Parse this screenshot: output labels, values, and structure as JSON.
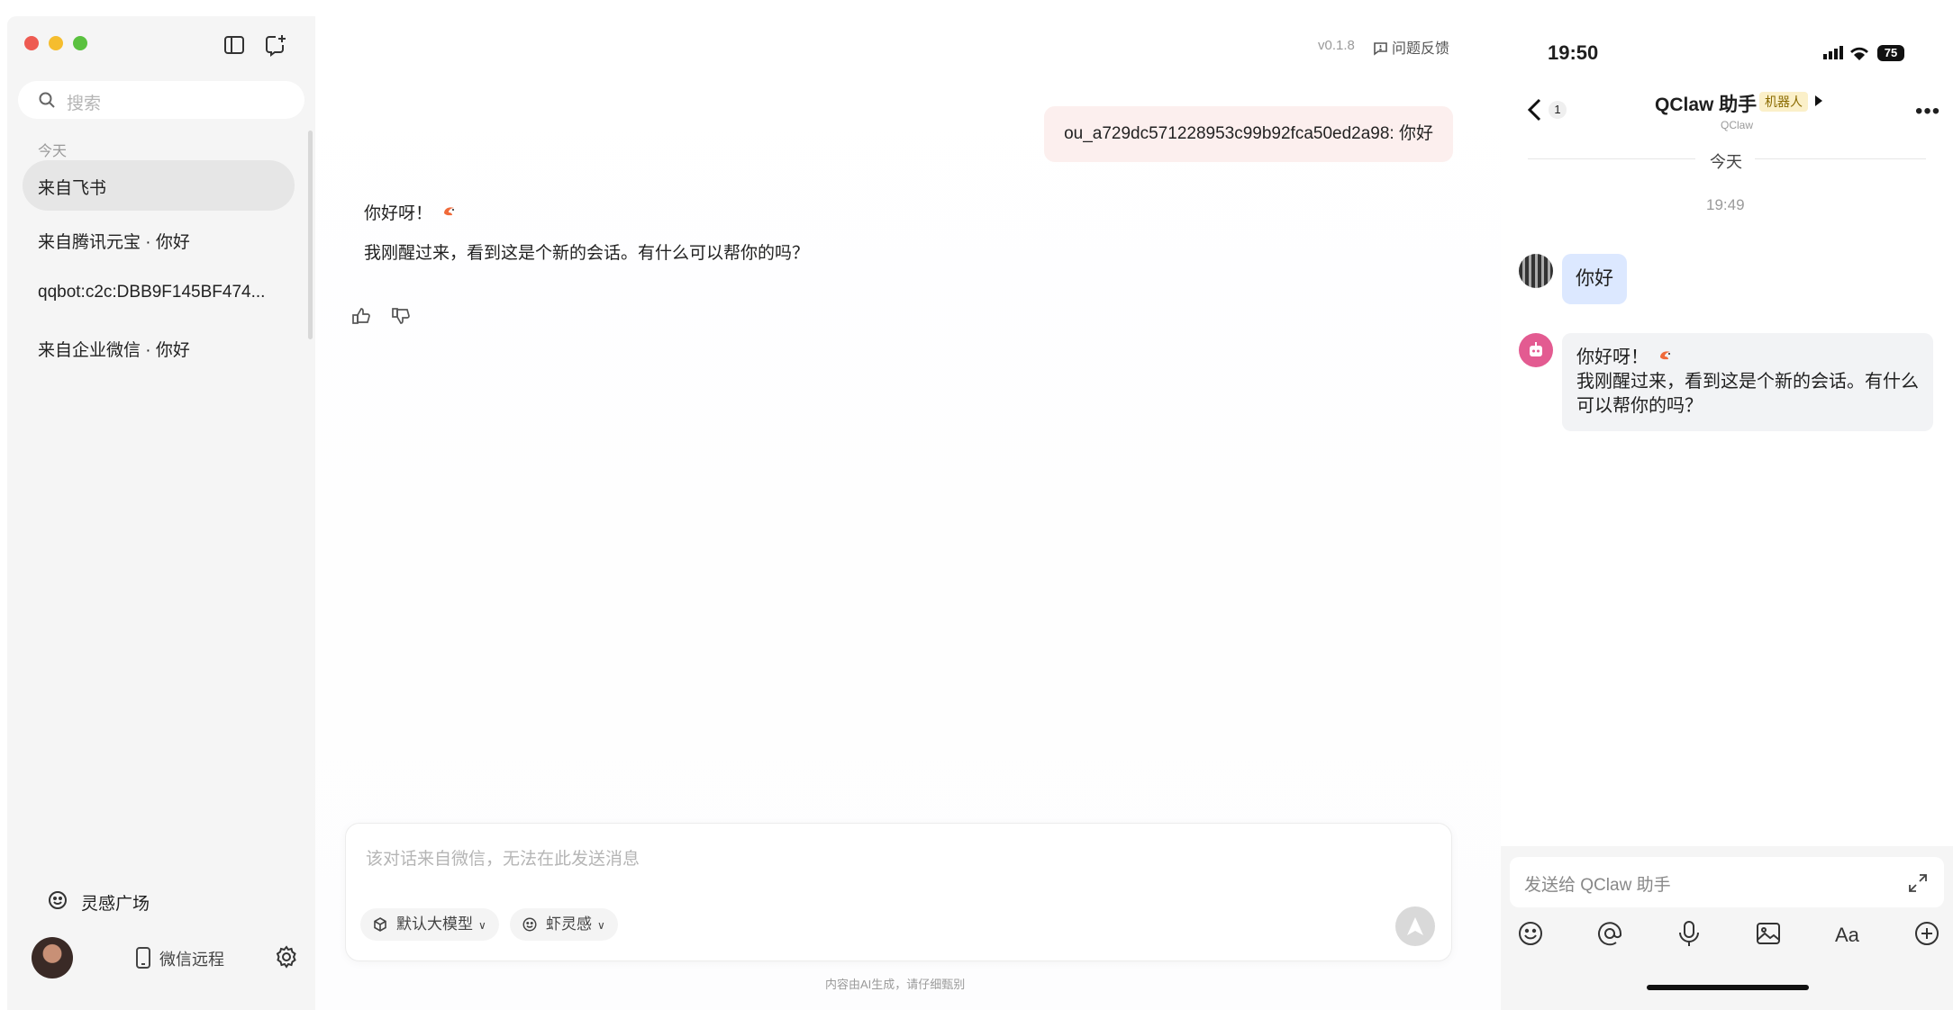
{
  "app": {
    "version": "v0.1.8",
    "feedback_label": "问题反馈"
  },
  "sidebar": {
    "search_placeholder": "搜索",
    "section_today": "今天",
    "conversations": [
      {
        "label": "来自飞书",
        "active": true
      },
      {
        "label": "来自腾讯元宝 · 你好"
      },
      {
        "label": "qqbot:c2c:DBB9F145BF474..."
      },
      {
        "label": "来自企业微信 · 你好"
      }
    ],
    "inspiration_label": "灵感广场",
    "remote_label": "微信远程"
  },
  "chat": {
    "user_message": "ou_a729dc571228953c99b92fca50ed2a98: 你好",
    "ai_line1": "你好呀！",
    "ai_line2": "我刚醒过来，看到这是个新的会话。有什么可以帮你的吗？",
    "composer_placeholder": "该对话来自微信，无法在此发送消息",
    "model_chip": "默认大模型",
    "inspire_chip": "虾灵感",
    "disclaimer": "内容由AI生成，请仔细甄别"
  },
  "phone": {
    "time": "19:50",
    "battery": "75",
    "back_count": "1",
    "title": "QClaw 助手",
    "badge": "机器人",
    "subtitle": "QClaw",
    "date_divider": "今天",
    "timestamp": "19:49",
    "user_msg": "你好",
    "bot_line1": "你好呀！",
    "bot_line2": "我刚醒过来，看到这是个新的会话。有什么可以帮你的吗？",
    "input_placeholder": "发送给 QClaw 助手",
    "toolbar_icons": [
      "emoji-icon",
      "at-icon",
      "mic-icon",
      "image-icon",
      "font-icon",
      "add-icon"
    ]
  },
  "colors": {
    "user_bubble": "#fcefee",
    "phone_user_bubble": "#dce8ff",
    "bot_avatar": "#e35b91",
    "badge_bg": "#fbf0c9"
  }
}
